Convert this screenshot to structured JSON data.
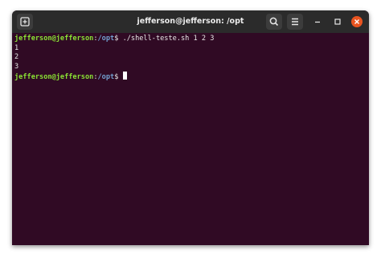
{
  "window": {
    "title": "jefferson@jefferson: /opt"
  },
  "toolbar": {
    "new_tab_icon": "new-tab-icon",
    "search_icon": "search-icon",
    "menu_icon": "hamburger-menu-icon",
    "minimize_icon": "minimize-icon",
    "maximize_icon": "maximize-icon",
    "close_icon": "close-icon"
  },
  "terminal": {
    "prompt_user": "jefferson@jefferson",
    "prompt_sep": ":",
    "prompt_path": "/opt",
    "prompt_symbol": "$",
    "command": " ./shell-teste.sh 1 2 3",
    "output": [
      "1",
      "2",
      "3"
    ]
  },
  "colors": {
    "terminal_bg": "#300a24",
    "titlebar_bg": "#2b2b2b",
    "prompt_user": "#8ae234",
    "prompt_path": "#729fcf",
    "close_button": "#e95420"
  }
}
